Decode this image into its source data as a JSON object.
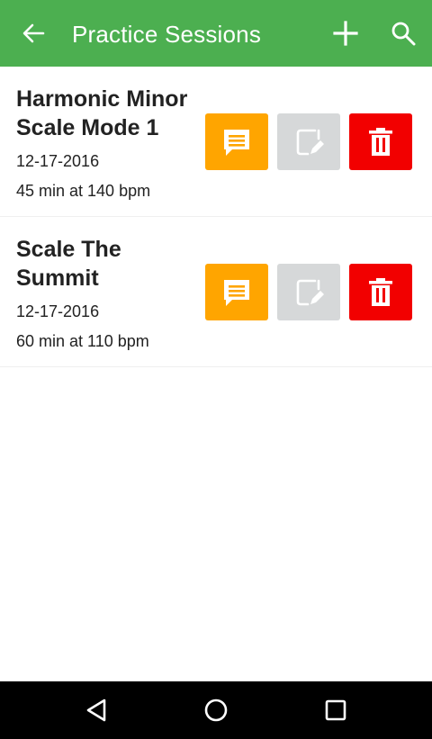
{
  "app_bar": {
    "title": "Practice Sessions",
    "back_icon": "arrow-left-icon",
    "add_icon": "plus-icon",
    "search_icon": "search-icon",
    "background_color": "#4caf50"
  },
  "sessions": [
    {
      "name": "Harmonic Minor Scale Mode 1",
      "date": "12-17-2016",
      "stats": "45 min at 140 bpm"
    },
    {
      "name": "Scale The Summit",
      "date": "12-17-2016",
      "stats": "60 min at 110 bpm"
    }
  ],
  "row_actions": {
    "notes_icon": "comment-icon",
    "edit_icon": "edit-icon",
    "delete_icon": "trash-icon",
    "notes_color": "#ffa500",
    "edit_color": "#d6d8d9",
    "delete_color": "#f20000"
  },
  "nav_bar": {
    "back_icon": "triangle-back-icon",
    "home_icon": "circle-home-icon",
    "recents_icon": "square-recents-icon"
  }
}
